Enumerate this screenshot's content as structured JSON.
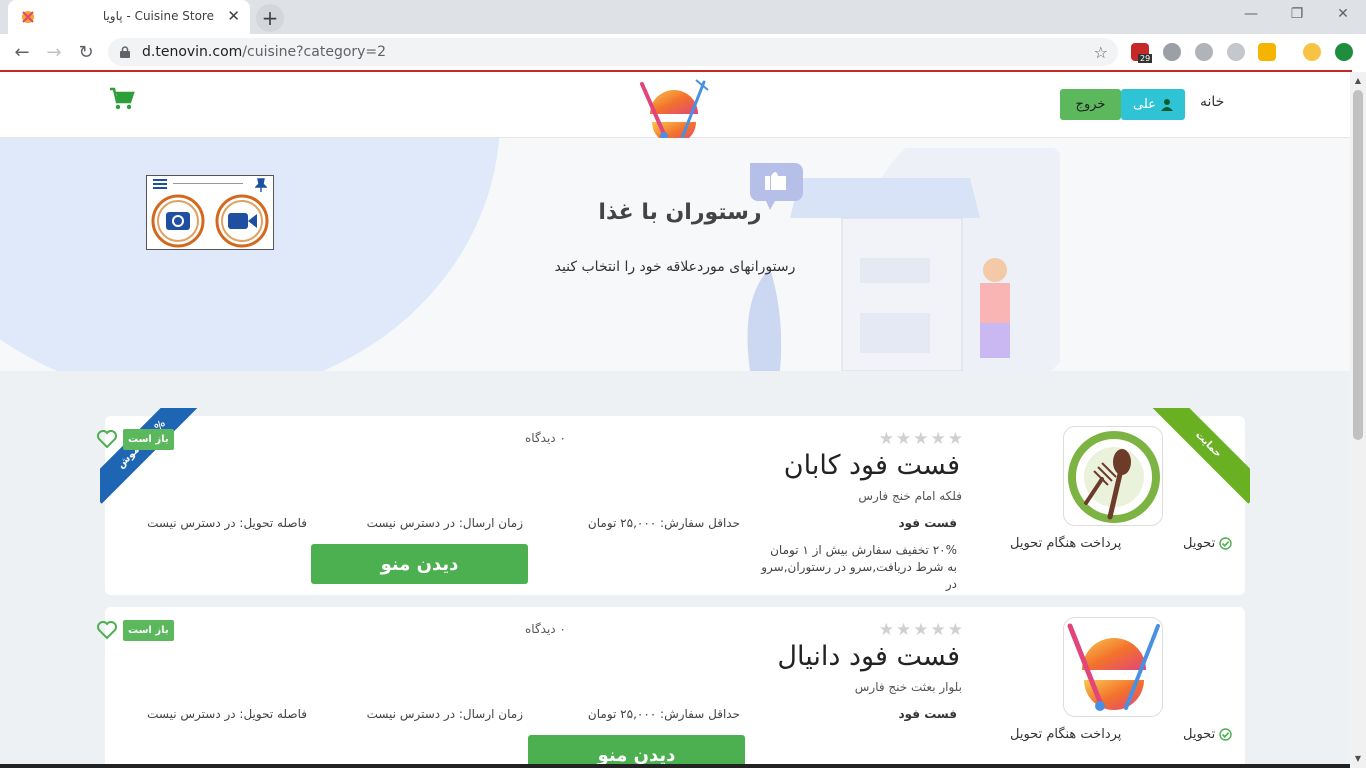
{
  "browser": {
    "tab_title": "Cuisine Store - پاویا",
    "url_host": "d.tenovin.com",
    "url_path": "/cuisine?category=2",
    "calendar_badge": "29",
    "controls": {
      "minimize": "—",
      "maximize": "❐",
      "close": "✕"
    }
  },
  "header": {
    "home_label": "خانه",
    "user_label": "علی",
    "logout_label": "خروج"
  },
  "hero": {
    "title": "رستوران با غذا",
    "subtitle": "رستورانهای موردعلاقه خود را انتخاب کنید"
  },
  "restaurants": [
    {
      "name": "فست فود کابان",
      "address": "فلکه امام خنج فارس",
      "category": "فست فود",
      "min_order": "حداقل سفارش: ۲۵,۰۰۰ تومان",
      "send_time": "زمان ارسال: در دسترس نیست",
      "distance": "فاصله تحویل: در دسترس نیست",
      "views": "۰ دیدگاه",
      "delivery": "تحویل",
      "payment": "پرداخت هنگام تحویل",
      "discount_desc": "۲۰% تخفیف سفارش بیش از ۱ تومان به شرط دریافت,سرو در رستوران,سرو در",
      "menu_label": "دیدن منو",
      "rating": 0,
      "ribbon_left": "۲۰% خاموش",
      "ribbon_right": "حمایت",
      "open_badge": "باز است"
    },
    {
      "name": "فست فود دانیال",
      "address": "بلوار بعثت خنج فارس",
      "category": "فست فود",
      "min_order": "حداقل سفارش: ۲۵,۰۰۰ تومان",
      "send_time": "زمان ارسال: در دسترس نیست",
      "distance": "فاصله تحویل: در دسترس نیست",
      "views": "۰ دیدگاه",
      "delivery": "تحویل",
      "payment": "پرداخت هنگام تحویل",
      "menu_label": "دیدن منو",
      "rating": 0,
      "open_badge": "باز است"
    }
  ],
  "colors": {
    "green": "#4caf50",
    "cyan": "#2ec4d6",
    "blue_ribbon": "#1e66b3",
    "green_ribbon": "#6ab023"
  }
}
